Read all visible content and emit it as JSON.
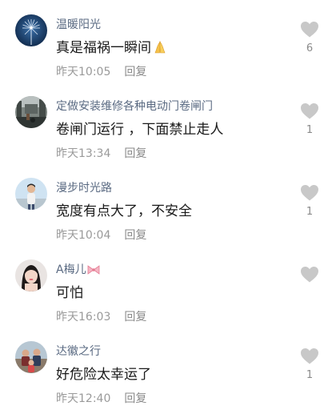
{
  "colors": {
    "username": "#5a6a82",
    "content": "#1a1a1a",
    "meta": "#9a9a9a",
    "like_heart": "#c8c8c8",
    "ribbon": "#f08aa0"
  },
  "comments": [
    {
      "username": "温暖阳光",
      "content": "真是福祸一瞬间",
      "content_emoji": "folded-hands-emoji",
      "time": "昨天10:05",
      "reply": "回复",
      "likes": "6",
      "avatar": "dandelion-avatar"
    },
    {
      "username": "定做安装维修各种电动门卷闸门",
      "content": "卷闸门运行 ，下面禁止走人",
      "time": "昨天13:34",
      "reply": "回复",
      "likes": "1",
      "avatar": "street-scene-avatar"
    },
    {
      "username": "漫步时光路",
      "content": "宽度有点大了，不安全",
      "time": "昨天10:04",
      "reply": "回复",
      "likes": "1",
      "avatar": "man-outdoor-avatar"
    },
    {
      "username": "A梅儿",
      "username_emoji": "ribbon-emoji",
      "content": "可怕",
      "time": "昨天16:03",
      "reply": "回复",
      "likes": "",
      "avatar": "woman-portrait-avatar"
    },
    {
      "username": "达徽之行",
      "content": "好危险太幸运了",
      "time": "昨天12:40",
      "reply": "回复",
      "likes": "1",
      "avatar": "family-photo-avatar"
    }
  ]
}
